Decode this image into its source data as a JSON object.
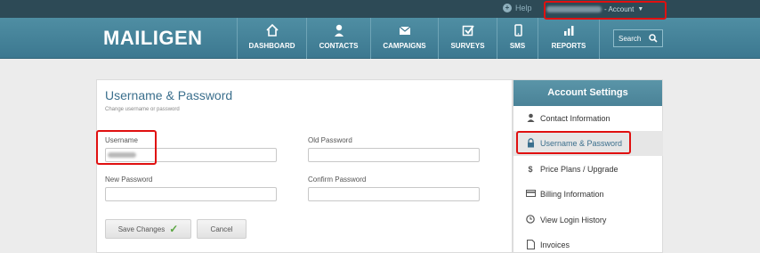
{
  "topbar": {
    "help_label": "Help",
    "account_label": "- Account"
  },
  "nav": {
    "logo": "MAILIGEN",
    "items": [
      {
        "label": "DASHBOARD",
        "icon": "home-icon"
      },
      {
        "label": "CONTACTS",
        "icon": "person-icon"
      },
      {
        "label": "CAMPAIGNS",
        "icon": "envelope-icon"
      },
      {
        "label": "SURVEYS",
        "icon": "checkbox-icon"
      },
      {
        "label": "SMS",
        "icon": "phone-icon"
      },
      {
        "label": "REPORTS",
        "icon": "bar-chart-icon"
      }
    ],
    "search_label": "Search"
  },
  "form": {
    "title": "Username & Password",
    "subtitle": "Change username or password",
    "username_label": "Username",
    "old_password_label": "Old Password",
    "new_password_label": "New Password",
    "confirm_password_label": "Confirm Password",
    "save_label": "Save Changes",
    "cancel_label": "Cancel"
  },
  "sidebar": {
    "title": "Account Settings",
    "items": [
      {
        "label": "Contact Information",
        "icon": "user-icon"
      },
      {
        "label": "Username & Password",
        "icon": "lock-icon",
        "active": true
      },
      {
        "label": "Price Plans / Upgrade",
        "icon": "dollar-icon"
      },
      {
        "label": "Billing Information",
        "icon": "credit-card-icon"
      },
      {
        "label": "View Login History",
        "icon": "clock-icon"
      },
      {
        "label": "Invoices",
        "icon": "document-icon"
      }
    ]
  },
  "colors": {
    "nav_bg": "#4a86a0",
    "topbar_bg": "#2d4a56",
    "accent_title": "#3b6f8d",
    "highlight_box": "#e01010"
  }
}
